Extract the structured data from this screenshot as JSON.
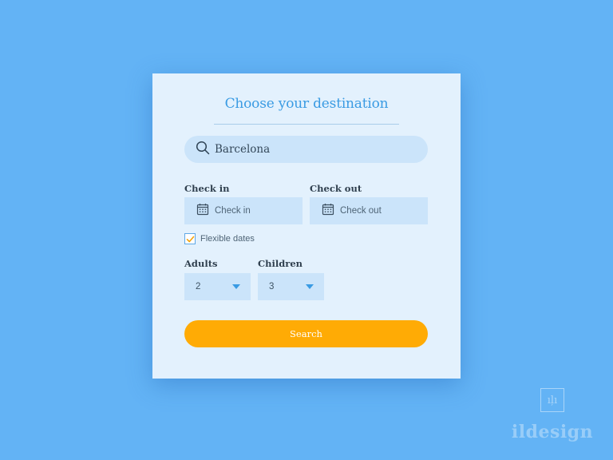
{
  "form": {
    "title": "Choose your destination",
    "search": {
      "value": "Barcelona",
      "icon": "search-icon"
    },
    "check_in": {
      "label": "Check in",
      "placeholder": "Check in",
      "icon": "calendar-icon"
    },
    "check_out": {
      "label": "Check out",
      "placeholder": "Check out",
      "icon": "calendar-icon"
    },
    "flexible_dates": {
      "label": "Flexible dates",
      "checked": true
    },
    "adults": {
      "label": "Adults",
      "value": "2"
    },
    "children": {
      "label": "Children",
      "value": "3"
    },
    "submit_label": "Search"
  },
  "watermark": {
    "mark": "ıļı",
    "text": "ildesign"
  },
  "colors": {
    "background": "#63b3f5",
    "card": "#e3f1fd",
    "field": "#cbe4fa",
    "accent": "#3a9be3",
    "button": "#ffab05"
  }
}
